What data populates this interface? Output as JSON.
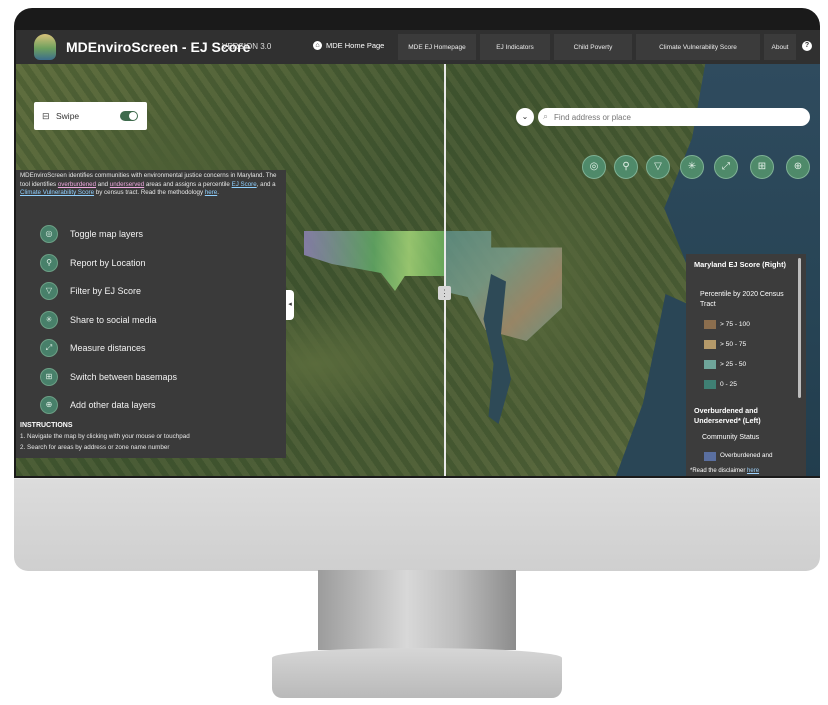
{
  "header": {
    "title": "MDEnviroScreen - EJ Score",
    "version": "VERSION 3.0",
    "home_link": "MDE Home Page",
    "tabs": [
      {
        "label": "MDE EJ Homepage"
      },
      {
        "label": "EJ Indicators"
      },
      {
        "label": "Child Poverty"
      },
      {
        "label": "Climate Vulnerability Score"
      },
      {
        "label": "About"
      }
    ],
    "help": "?"
  },
  "swipe": {
    "label": "Swipe",
    "enabled": true
  },
  "search": {
    "placeholder": "Find address or place"
  },
  "panel": {
    "desc_1": "MDEnviroScreen  identifies communities with environmental justice concerns in Maryland. The tool identifies ",
    "link_overburdened": "overburdened",
    "desc_2": " and ",
    "link_underserved": "underserved",
    "desc_3": " areas and assigns a percentile ",
    "link_ejscore": "EJ Score",
    "desc_4": ", and a ",
    "link_climate": "Climate Vulnerability Score",
    "desc_5": " by census tract. Read the methodology ",
    "link_here": "here",
    "desc_6": ".",
    "menu": [
      {
        "label": "Toggle map layers",
        "icon": "layers-icon"
      },
      {
        "label": "Report by Location",
        "icon": "location-report-icon"
      },
      {
        "label": "Filter by EJ Score",
        "icon": "filter-icon"
      },
      {
        "label": "Share to social media",
        "icon": "share-icon"
      },
      {
        "label": "Measure distances",
        "icon": "measure-icon"
      },
      {
        "label": "Switch between basemaps",
        "icon": "basemap-icon"
      },
      {
        "label": "Add other data layers",
        "icon": "add-layers-icon"
      }
    ],
    "instructions_title": "INSTRUCTIONS",
    "instruction_1": "1. Navigate the map by clicking with your mouse or touchpad",
    "instruction_2": "2. Search for areas by address or zone name number"
  },
  "legend": {
    "title_right": "Maryland EJ Score (Right)",
    "subtitle": "Percentile by 2020 Census Tract",
    "classes": [
      {
        "label": "> 75 - 100",
        "color": "#8b6e4e"
      },
      {
        "label": "> 50 - 75",
        "color": "#b59a6a"
      },
      {
        "label": "> 25 - 50",
        "color": "#6fa59a"
      },
      {
        "label": "0 - 25",
        "color": "#3f7f73"
      }
    ],
    "title_left": "Overburdened and Underserved* (Left)",
    "community_status": "Community Status",
    "overburdened_item": "Overburdened and",
    "overburdened_color": "#5a6fa0",
    "disclaimer_prefix": "*Read the disclaimer ",
    "disclaimer_link": "here"
  },
  "colors": {
    "accent": "#4f8a6a",
    "header_bg": "#303030",
    "panel_bg": "#3a3a3a"
  }
}
